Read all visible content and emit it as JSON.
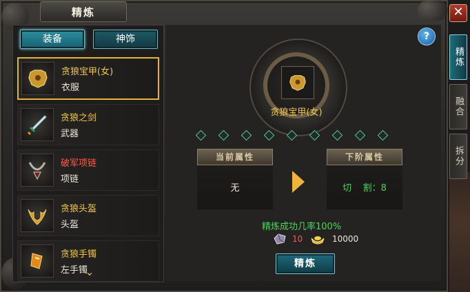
{
  "window": {
    "title": "精炼",
    "close_label": "✕"
  },
  "side_tabs": [
    {
      "label": "精炼",
      "active": true
    },
    {
      "label": "融合",
      "active": false
    },
    {
      "label": "拆分",
      "active": false
    }
  ],
  "category_tabs": {
    "equip": "装备",
    "deco": "神饰"
  },
  "items": [
    {
      "name": "贪狼宝甲(女)",
      "type": "衣服",
      "name_color": "gold",
      "selected": true,
      "icon": "armor-icon"
    },
    {
      "name": "贪狼之剑",
      "type": "武器",
      "name_color": "gold",
      "selected": false,
      "icon": "sword-icon"
    },
    {
      "name": "破军项链",
      "type": "项链",
      "name_color": "red",
      "selected": false,
      "icon": "necklace-icon"
    },
    {
      "name": "贪狼头盔",
      "type": "头盔",
      "name_color": "gold",
      "selected": false,
      "icon": "helmet-icon"
    },
    {
      "name": "贪狼手镯",
      "type": "左手镯",
      "name_color": "gold",
      "selected": false,
      "icon": "bracelet-icon"
    }
  ],
  "target": {
    "name": "贪狼宝甲(女)"
  },
  "progress": {
    "total_slots": 9,
    "filled": 0
  },
  "current_attr": {
    "header": "当前属性",
    "value": "无"
  },
  "next_attr": {
    "header": "下阶属性",
    "value": "切    割：8"
  },
  "success": {
    "text": "精炼成功几率100%"
  },
  "cost": {
    "stone_count": "10",
    "gold_count": "10000"
  },
  "refine_button": "精炼",
  "colors": {
    "gold_text": "#f0c84a",
    "red_text": "#ff5a4a",
    "green_text": "#49d65a",
    "accent_teal": "#1f6b7c"
  }
}
